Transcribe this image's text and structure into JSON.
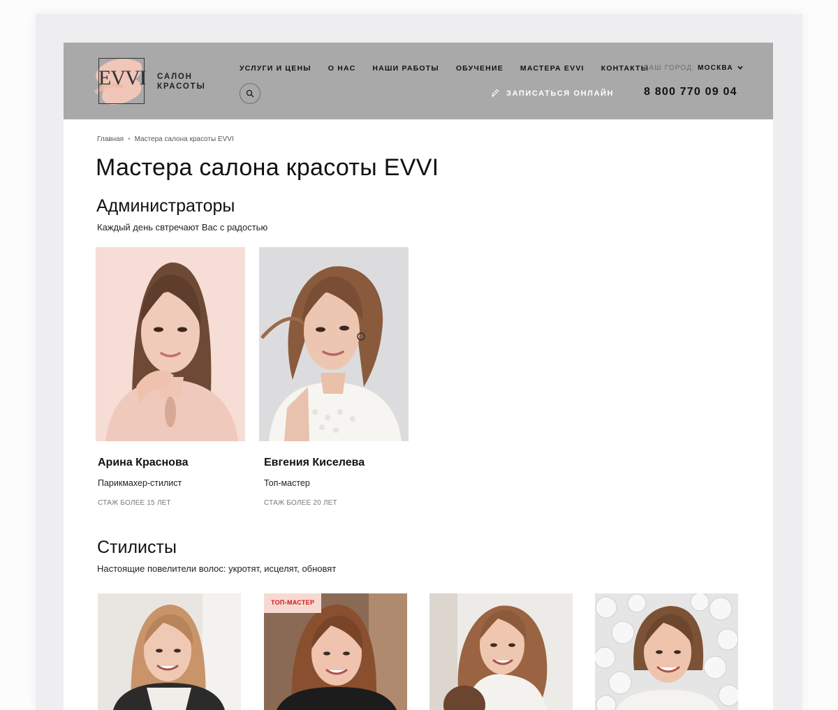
{
  "header": {
    "logo_mark": "EVVI",
    "logo_line1": "САЛОН",
    "logo_line2": "КРАСОТЫ",
    "nav": [
      {
        "label": "УСЛУГИ И ЦЕНЫ"
      },
      {
        "label": "О НАС"
      },
      {
        "label": "НАШИ РАБОТЫ"
      },
      {
        "label": "ОБУЧЕНИЕ"
      },
      {
        "label": "МАСТЕРА EVVI"
      },
      {
        "label": "КОНТАКТЫ"
      }
    ],
    "city_label": "ВАШ ГОРОД:",
    "city_value": "МОСКВА",
    "book_label": "ЗАПИСАТЬСЯ ОНЛАЙН",
    "phone": "8 800 770 09 04"
  },
  "breadcrumb": {
    "home": "Главная",
    "current": "Мастера салона красоты EVVI"
  },
  "page_title": "Мастера салона красоты EVVI",
  "sections": [
    {
      "title": "Администраторы",
      "subtitle": "Каждый день свтречают Вас с радостью",
      "masters": [
        {
          "name": "Арина Краснова",
          "role": "Парикмахер-стилист",
          "experience": "СТАЖ БОЛЕЕ 15 ЛЕТ"
        },
        {
          "name": "Евгения Киселева",
          "role": "Топ-мастер",
          "experience": "СТАЖ БОЛЕЕ 20 ЛЕТ"
        }
      ]
    },
    {
      "title": "Стилисты",
      "subtitle": "Настоящие повелители волос: укротят, исцелят, обновят",
      "masters": [
        {
          "badge": ""
        },
        {
          "badge": "ТОП-МАСТЕР"
        },
        {
          "badge": ""
        },
        {
          "badge": ""
        }
      ]
    }
  ],
  "colors": {
    "header_bg": "#a9a9a9",
    "accent_pink": "#f3c7b8",
    "badge_red": "#d8151c"
  }
}
